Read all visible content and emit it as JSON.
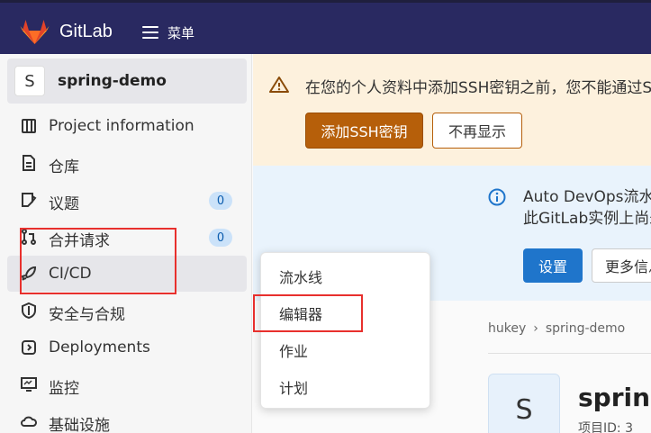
{
  "topbar": {
    "brand": "GitLab",
    "menu_label": "菜单"
  },
  "sidebar": {
    "project_avatar": "S",
    "project_name": "spring-demo",
    "items": [
      {
        "label": "Project information",
        "icon": "project-info-icon"
      },
      {
        "label": "仓库",
        "icon": "document-icon"
      },
      {
        "label": "议题",
        "icon": "issues-icon",
        "badge": "0"
      },
      {
        "label": "合并请求",
        "icon": "merge-request-icon",
        "badge": "0"
      },
      {
        "label": "CI/CD",
        "icon": "rocket-icon"
      },
      {
        "label": "安全与合规",
        "icon": "shield-icon"
      },
      {
        "label": "Deployments",
        "icon": "deployments-icon"
      },
      {
        "label": "监控",
        "icon": "monitor-icon"
      },
      {
        "label": "基础设施",
        "icon": "cloud-icon"
      }
    ]
  },
  "ssh_alert": {
    "text": "在您的个人资料中添加SSH密钥之前，您不能通过SSH",
    "primary_button": "添加SSH密钥",
    "secondary_button": "不再显示"
  },
  "devops_alert": {
    "line1": "Auto DevOps流水线",
    "line2": "此GitLab实例上尚未",
    "settings_button": "设置",
    "more_button": "更多信息"
  },
  "breadcrumb": {
    "group": "hukey",
    "project": "spring-demo"
  },
  "project_header": {
    "avatar": "S",
    "title": "spring",
    "id_text": "项目ID: 3"
  },
  "cicd_menu": {
    "items": [
      "流水线",
      "编辑器",
      "作业",
      "计划"
    ]
  },
  "colors": {
    "topbar": "#292961",
    "warning_button": "#b65f0a",
    "primary_button": "#1f75cb",
    "highlight": "#e8302d"
  }
}
